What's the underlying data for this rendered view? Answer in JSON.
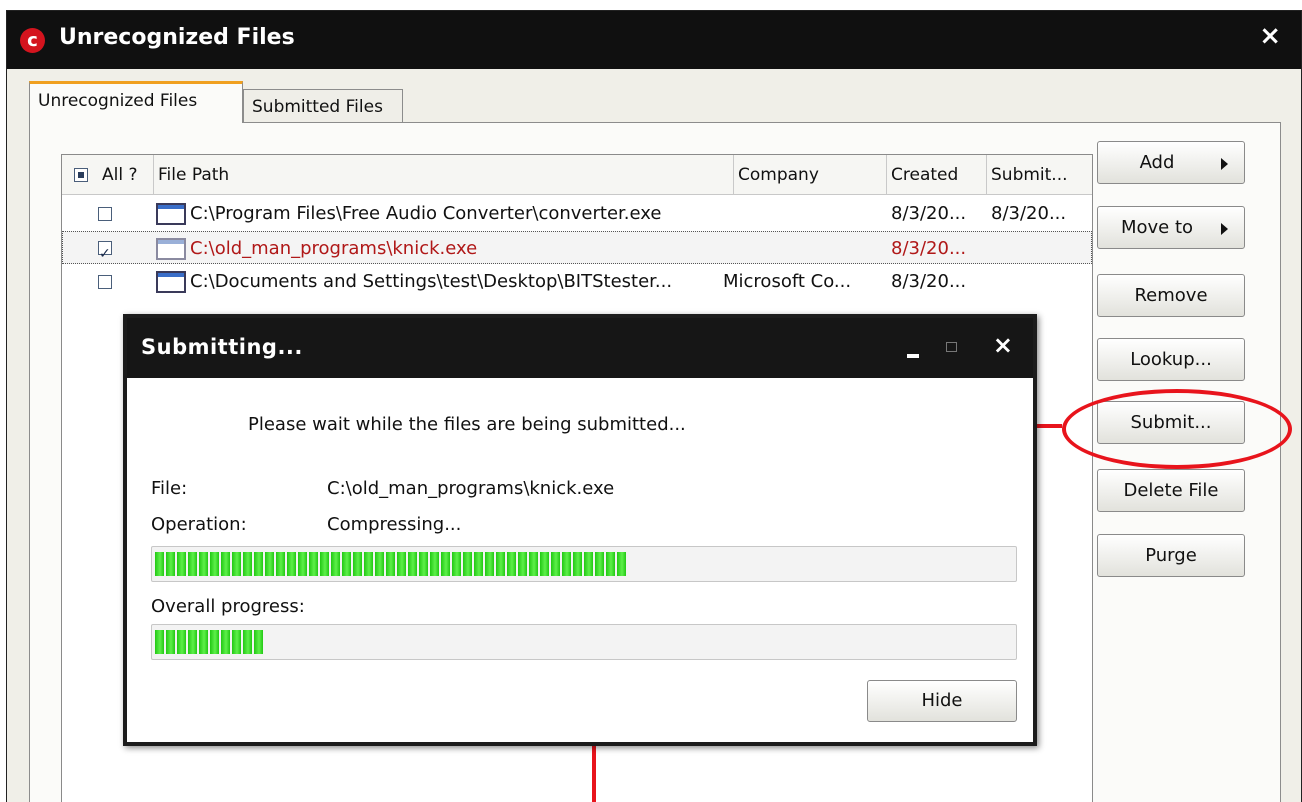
{
  "window": {
    "title": "Unrecognized Files",
    "close_glyph": "×",
    "logo_letter": "c"
  },
  "tabs": [
    {
      "label": "Unrecognized Files",
      "active": true
    },
    {
      "label": "Submitted Files",
      "active": false
    }
  ],
  "file_list": {
    "columns": {
      "all": "All ?",
      "file_path": "File Path",
      "company": "Company",
      "created": "Created",
      "submitted": "Submit..."
    },
    "rows": [
      {
        "checked": false,
        "path": "C:\\Program Files\\Free Audio Converter\\converter.exe",
        "company": "",
        "created": "8/3/20...",
        "submitted": "8/3/20..."
      },
      {
        "checked": true,
        "path": "C:\\old_man_programs\\knick.exe",
        "company": "",
        "created": "8/3/20...",
        "submitted": ""
      },
      {
        "checked": false,
        "path": "C:\\Documents and Settings\\test\\Desktop\\BITStester...",
        "company": "Microsoft Co...",
        "created": "8/3/20...",
        "submitted": ""
      }
    ]
  },
  "buttons": {
    "add": "Add",
    "move_to": "Move to",
    "remove": "Remove",
    "lookup": "Lookup...",
    "submit": "Submit...",
    "delete_file": "Delete File",
    "purge": "Purge"
  },
  "dialog": {
    "title": "Submitting...",
    "close_glyph": "×",
    "message": "Please wait while the files are being submitted...",
    "file_label": "File:",
    "file_value": "C:\\old_man_programs\\knick.exe",
    "operation_label": "Operation:",
    "operation_value": "Compressing...",
    "file_progress": 0.55,
    "overall_label": "Overall progress:",
    "overall_progress": 0.13,
    "hide_button": "Hide"
  },
  "colors": {
    "accent_tab": "#f0a020",
    "selected_row_text": "#b01818",
    "annotation": "#e8141c",
    "progress_green": "#22c814"
  }
}
